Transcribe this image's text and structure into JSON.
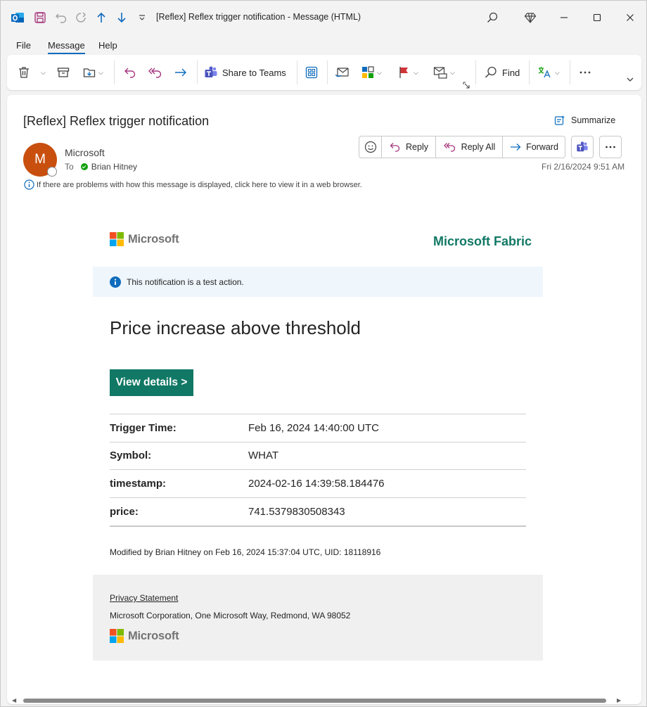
{
  "window": {
    "title": "[Reflex] Reflex trigger notification  -  Message (HTML)"
  },
  "menu": {
    "tabs": [
      {
        "label": "File"
      },
      {
        "label": "Message"
      },
      {
        "label": "Help"
      }
    ],
    "active": "Message"
  },
  "ribbon": {
    "share_to_teams": "Share to Teams",
    "find": "Find"
  },
  "message": {
    "subject": "[Reflex] Reflex trigger notification",
    "summarize": "Summarize",
    "avatar_initial": "M",
    "sender": "Microsoft",
    "to_label": "To",
    "recipient": "Brian Hitney",
    "reply": "Reply",
    "reply_all": "Reply All",
    "forward": "Forward",
    "date": "Fri 2/16/2024 9:51 AM",
    "info": "If there are problems with how this message is displayed, click here to view it in a web browser."
  },
  "email": {
    "brand": "Microsoft",
    "product": "Microsoft Fabric",
    "notice": "This notification is a test action.",
    "heading": "Price increase above threshold",
    "view_details": "View details >",
    "rows": [
      {
        "key": "Trigger Time:",
        "value": "Feb 16, 2024 14:40:00 UTC"
      },
      {
        "key": "Symbol:",
        "value": "WHAT"
      },
      {
        "key": "timestamp:",
        "value": "2024-02-16 14:39:58.184476"
      },
      {
        "key": "price:",
        "value": "741.5379830508343"
      }
    ],
    "modified": "Modified by Brian Hitney on Feb 16, 2024 15:37:04 UTC, UID: 18118916",
    "privacy": "Privacy Statement",
    "address": "Microsoft Corporation, One Microsoft Way, Redmond, WA 98052",
    "footer_brand": "Microsoft"
  },
  "colors": {
    "accent": "#0f6cbd",
    "fabric_green": "#117865",
    "avatar": "#c94f0f"
  }
}
